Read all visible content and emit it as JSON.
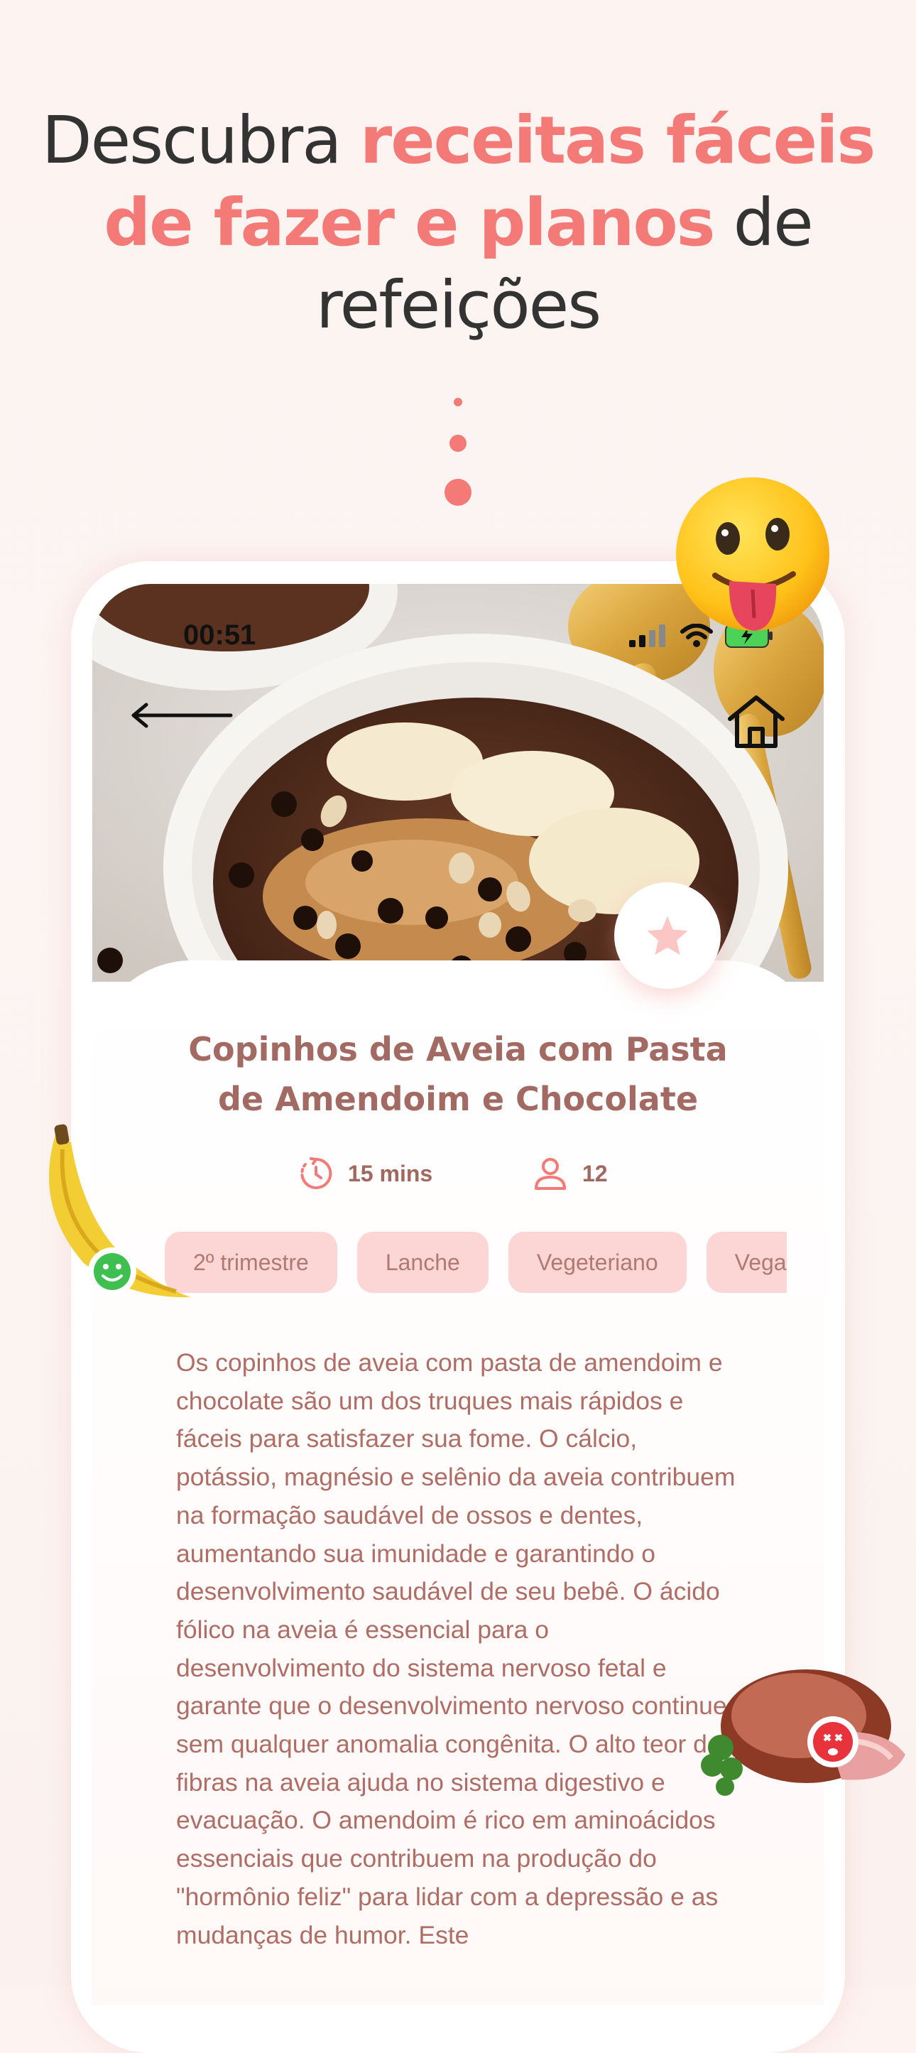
{
  "headline": {
    "part1": "Descubra ",
    "accent1": "receitas fáceis",
    "accent2": "de fazer e planos",
    "part2": " de",
    "part3": "refeições"
  },
  "status_bar": {
    "time": "00:51"
  },
  "nav": {
    "back_icon": "arrow-left-icon",
    "home_icon": "home-icon",
    "favorite_icon": "star-icon"
  },
  "recipe": {
    "title_line1": "Copinhos de Aveia com Pasta",
    "title_line2": "de Amendoim e Chocolate",
    "time": "15 mins",
    "servings": "12",
    "tags": [
      "2º trimestre",
      "Lanche",
      "Vegeteriano",
      "Vegano"
    ],
    "description": "Os copinhos de aveia com pasta de amendoim e chocolate são um dos truques mais rápidos e fáceis para satisfazer sua fome. O cálcio, potássio, magnésio e selênio da aveia contribuem na formação saudável de ossos e dentes, aumentando sua imunidade e garantindo o desenvolvimento saudável de seu bebê. O ácido fólico na aveia é essencial para o desenvolvimento do sistema nervoso fetal e garante que o desenvolvimento nervoso continue sem qualquer anomalia congênita. O alto teor de fibras na aveia ajuda no sistema digestivo e evacuação. O amendoim é rico em aminoácidos essenciais que contribuem na produção do \"hormônio feliz\" para lidar com a depressão e as mudanças de humor. Este"
  },
  "colors": {
    "accent": "#f47a78",
    "title": "#a26a62",
    "text": "#b06d65",
    "tag_bg": "#fcd6d4"
  }
}
